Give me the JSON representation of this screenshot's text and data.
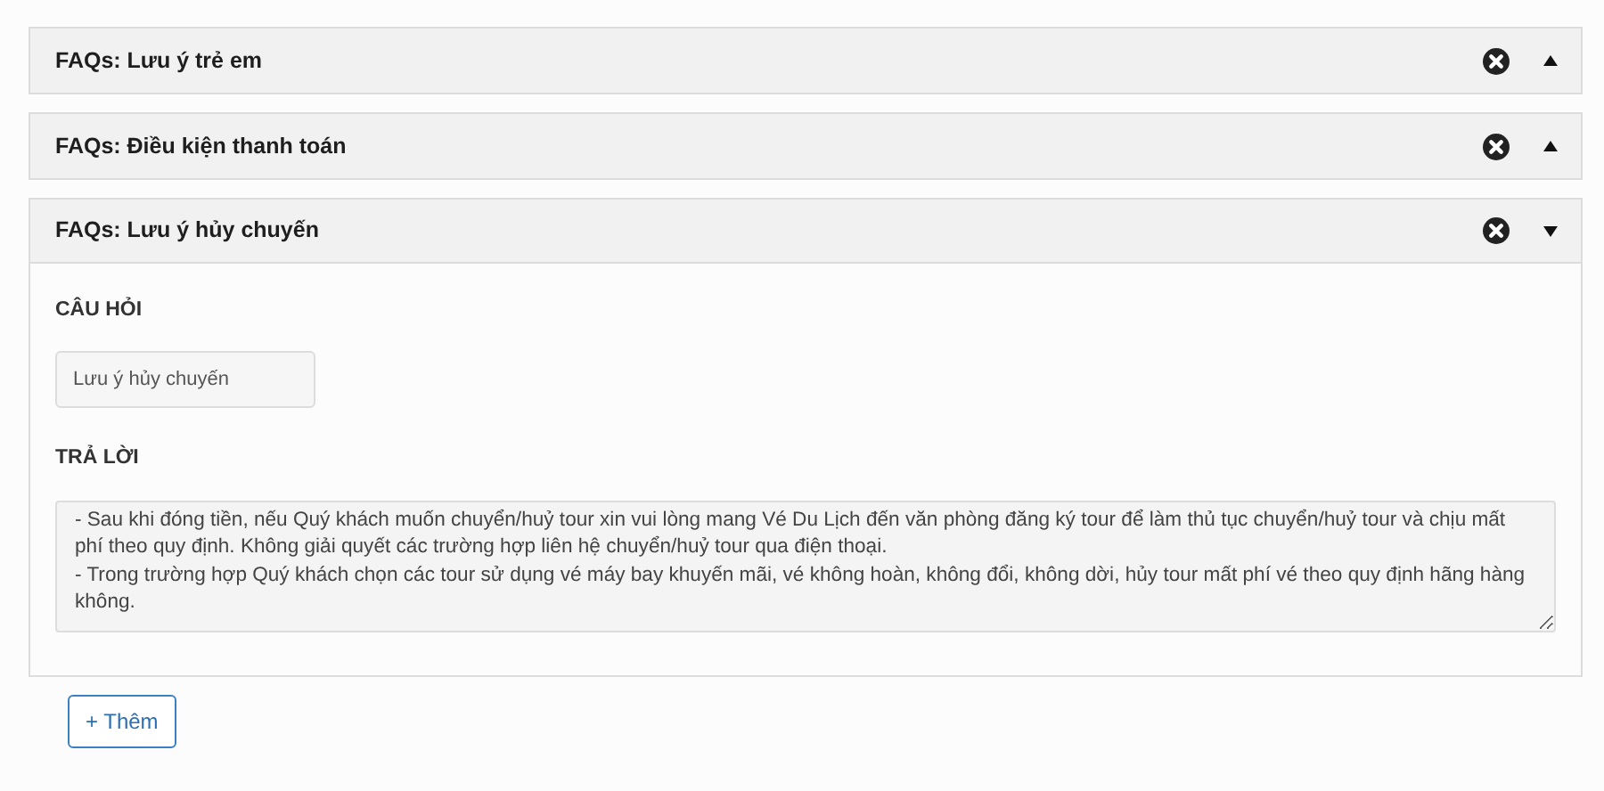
{
  "faqs": [
    {
      "title": "FAQs: Lưu ý trẻ em",
      "expanded": false
    },
    {
      "title": "FAQs: Điều kiện thanh toán",
      "expanded": false
    },
    {
      "title": "FAQs: Lưu ý hủy chuyến",
      "expanded": true,
      "question_label": "CÂU HỎI",
      "question_value": "Lưu ý hủy chuyến",
      "answer_label": "TRẢ LỜI",
      "answer_value": "- Sau khi đóng tiền, nếu Quý khách muốn chuyển/huỷ tour xin vui lòng mang Vé Du Lịch đến văn phòng đăng ký tour để làm thủ tục chuyển/huỷ tour và chịu mất phí theo quy định. Không giải quyết các trường hợp liên hệ chuyển/huỷ tour qua điện thoại.\n- Trong trường hợp Quý khách chọn các tour sử dụng vé máy bay khuyến mãi, vé không hoàn, không đổi, không dời, hủy tour mất phí vé theo quy định hãng hàng không."
    }
  ],
  "add_button": "+ Thêm"
}
